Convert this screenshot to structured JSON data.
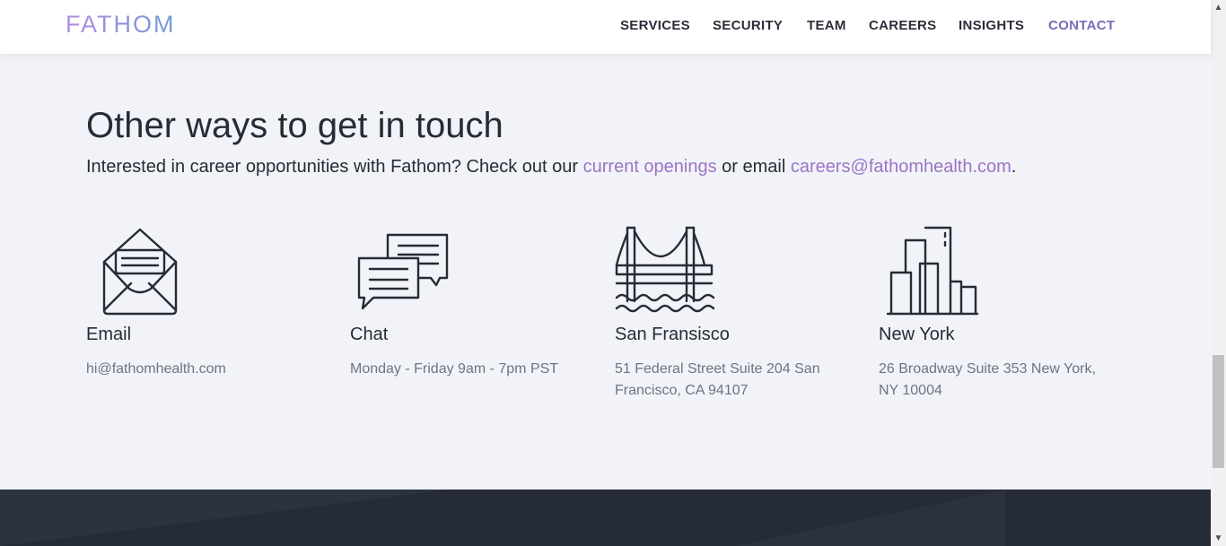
{
  "header": {
    "logo": "FATHOM",
    "nav": [
      "SERVICES",
      "SECURITY",
      "TEAM",
      "CAREERS",
      "INSIGHTS",
      "CONTACT"
    ]
  },
  "section": {
    "title": "Other ways to get in touch",
    "lead_prefix": "Interested in career opportunities with Fathom? Check out our ",
    "lead_link1": "current openings",
    "lead_middle": " or email ",
    "lead_link2": "careers@fathomhealth.com",
    "lead_suffix": "."
  },
  "contacts": [
    {
      "icon": "envelope-icon",
      "title": "Email",
      "detail": "hi@fathomhealth.com"
    },
    {
      "icon": "chat-icon",
      "title": "Chat",
      "detail": "Monday - Friday 9am - 7pm PST"
    },
    {
      "icon": "bridge-icon",
      "title": "San Fransisco",
      "detail": "51 Federal Street Suite 204 San Francisco, CA 94107"
    },
    {
      "icon": "city-buildings-icon",
      "title": "New York",
      "detail": "26 Broadway Suite 353 New York, NY 10004"
    }
  ],
  "colors": {
    "accent": "#9b74c6",
    "nav_active": "#7b6bb5",
    "text_dark": "#262b35",
    "text_muted": "#6c7483",
    "background": "#f2f3f8",
    "footer": "#262c37"
  }
}
